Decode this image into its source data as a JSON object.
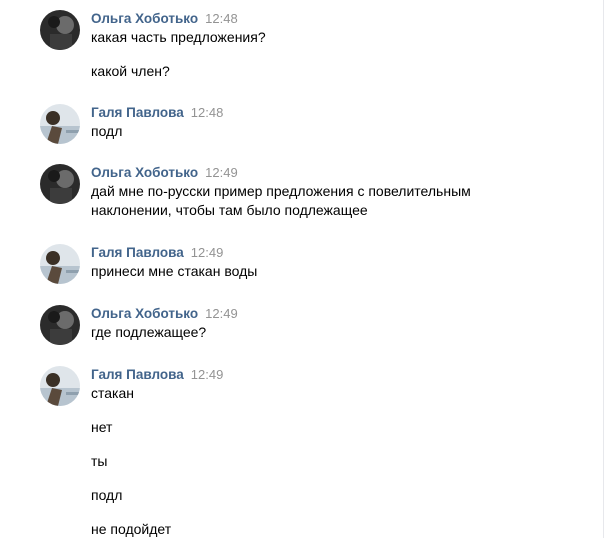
{
  "chat": {
    "messages": [
      {
        "author": "Ольга Хоботько",
        "time": "12:48",
        "avatar_icon": "user-photo-dark",
        "lines": [
          "какая часть предложения?",
          "какой член?"
        ]
      },
      {
        "author": "Галя Павлова",
        "time": "12:48",
        "avatar_icon": "user-photo-light",
        "lines": [
          "подл"
        ]
      },
      {
        "author": "Ольга Хоботько",
        "time": "12:49",
        "avatar_icon": "user-photo-dark",
        "lines": [
          "дай мне по-русски пример предложения с повелительным",
          "наклонении, чтобы там было подлежащее"
        ]
      },
      {
        "author": "Галя Павлова",
        "time": "12:49",
        "avatar_icon": "user-photo-light",
        "lines": [
          "принеси мне стакан воды"
        ]
      },
      {
        "author": "Ольга Хоботько",
        "time": "12:49",
        "avatar_icon": "user-photo-dark",
        "lines": [
          "где подлежащее?"
        ]
      },
      {
        "author": "Галя Павлова",
        "time": "12:49",
        "avatar_icon": "user-photo-light",
        "lines": [
          "стакан",
          "нет",
          "ты",
          "подл",
          "не подойдет"
        ]
      }
    ]
  },
  "colors": {
    "author": "#42648b",
    "time": "#939393",
    "text": "#000000"
  }
}
